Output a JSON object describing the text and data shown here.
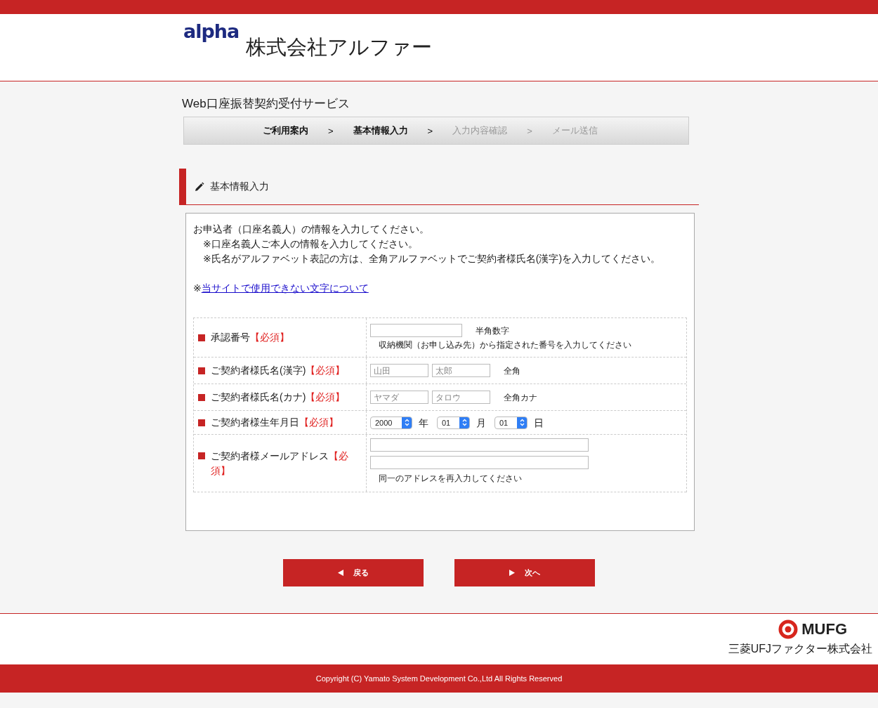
{
  "header": {
    "logo": "alpha",
    "company": "株式会社アルファー"
  },
  "service_title": "Web口座振替契約受付サービス",
  "steps": [
    {
      "label": "ご利用案内",
      "active": true
    },
    {
      "label": "基本情報入力",
      "active": true
    },
    {
      "label": "入力内容確認",
      "active": false
    },
    {
      "label": "メール送信",
      "active": false
    }
  ],
  "step_separators": [
    ">",
    ">",
    ">"
  ],
  "section_heading": "基本情報入力",
  "intro": {
    "lead": "お申込者（口座名義人）の情報を入力してください。",
    "notes": [
      "※口座名義人ご本人の情報を入力してください。",
      "※氏名がアルファベット表記の方は、全角アルファベットでご契約者様氏名(漢字)を入力してください。"
    ],
    "link_prefix": "※",
    "link": "当サイトで使用できない文字について"
  },
  "form_rows": [
    {
      "kind": "code",
      "label": "承認番号",
      "required": "【必須】",
      "unit": "半角数字",
      "hint": "収納機関（お申し込み先）から指定された番号を入力してください"
    },
    {
      "kind": "pair",
      "label": "ご契約者様氏名(漢字)",
      "required": "【必須】",
      "fields": [
        {
          "placeholder": "山田"
        },
        {
          "placeholder": "太郎"
        }
      ],
      "unit": "全角"
    },
    {
      "kind": "pair",
      "label": "ご契約者様氏名(カナ)",
      "required": "【必須】",
      "fields": [
        {
          "placeholder": "ヤマダ"
        },
        {
          "placeholder": "タロウ"
        }
      ],
      "unit": "全角カナ"
    },
    {
      "kind": "date",
      "label": "ご契約者様生年月日",
      "required": "【必須】",
      "selects": [
        {
          "value": "2000",
          "unit": "年"
        },
        {
          "value": "01",
          "unit": "月"
        },
        {
          "value": "01",
          "unit": "日"
        }
      ]
    },
    {
      "kind": "email",
      "label": "ご契約者様メールアドレス",
      "required": "【必須】",
      "hint": "同一のアドレスを再入力してください"
    }
  ],
  "buttons": [
    {
      "kind": "back",
      "label": "戻る"
    },
    {
      "kind": "next",
      "label": "次へ"
    }
  ],
  "footer": {
    "brand": "MUFG",
    "company": "三菱UFJファクター株式会社",
    "copyright": "Copyright (C) Yamato System Development Co.,Ltd All Rights Reserved"
  }
}
